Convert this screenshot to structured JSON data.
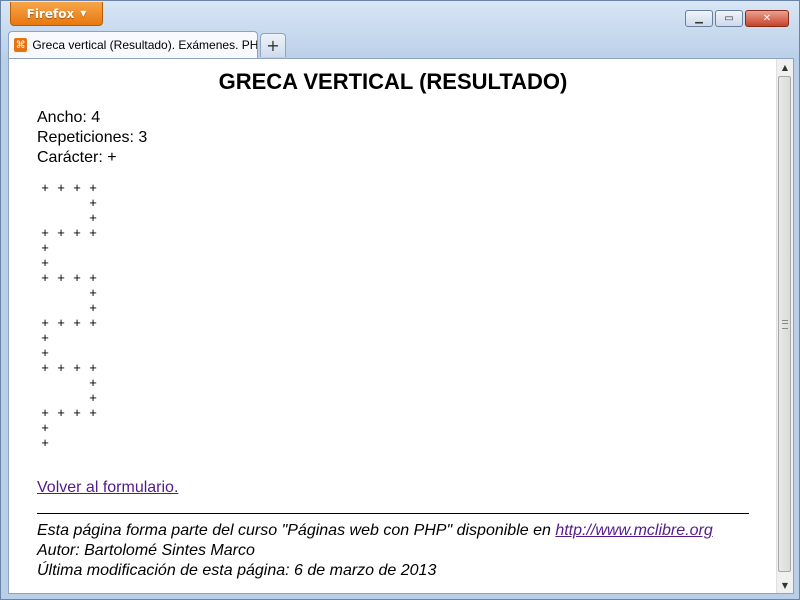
{
  "browser": {
    "menu_label": "Firefox",
    "tab_title": "Greca vertical (Resultado). Exámenes. PH...",
    "new_tab_symbol": "+"
  },
  "page": {
    "heading": "GRECA VERTICAL (RESULTADO)",
    "params": {
      "ancho": "Ancho: 4",
      "repeticiones": "Repeticiones: 3",
      "caracter": "Carácter: +"
    },
    "greca_rows": [
      "++++",
      "   +",
      "   +",
      "++++",
      "+",
      "+",
      "++++",
      "   +",
      "   +",
      "++++",
      "+",
      "+",
      "++++",
      "   +",
      "   +",
      "++++",
      "+",
      "+"
    ],
    "back_link": "Volver al formulario.",
    "footer": {
      "line1_text": "Esta página forma parte del curso \"Páginas web con PHP\" disponible en ",
      "line1_link": "http://www.mclibre.org",
      "line2": "Autor: Bartolomé Sintes Marco",
      "line3": "Última modificación de esta página: 6 de marzo de 2013"
    }
  },
  "icons": {
    "dropdown": "caret-down-icon",
    "favicon": "page-favicon-icon",
    "minimize": "minimize-icon",
    "maximize": "maximize-icon",
    "close": "close-icon"
  }
}
